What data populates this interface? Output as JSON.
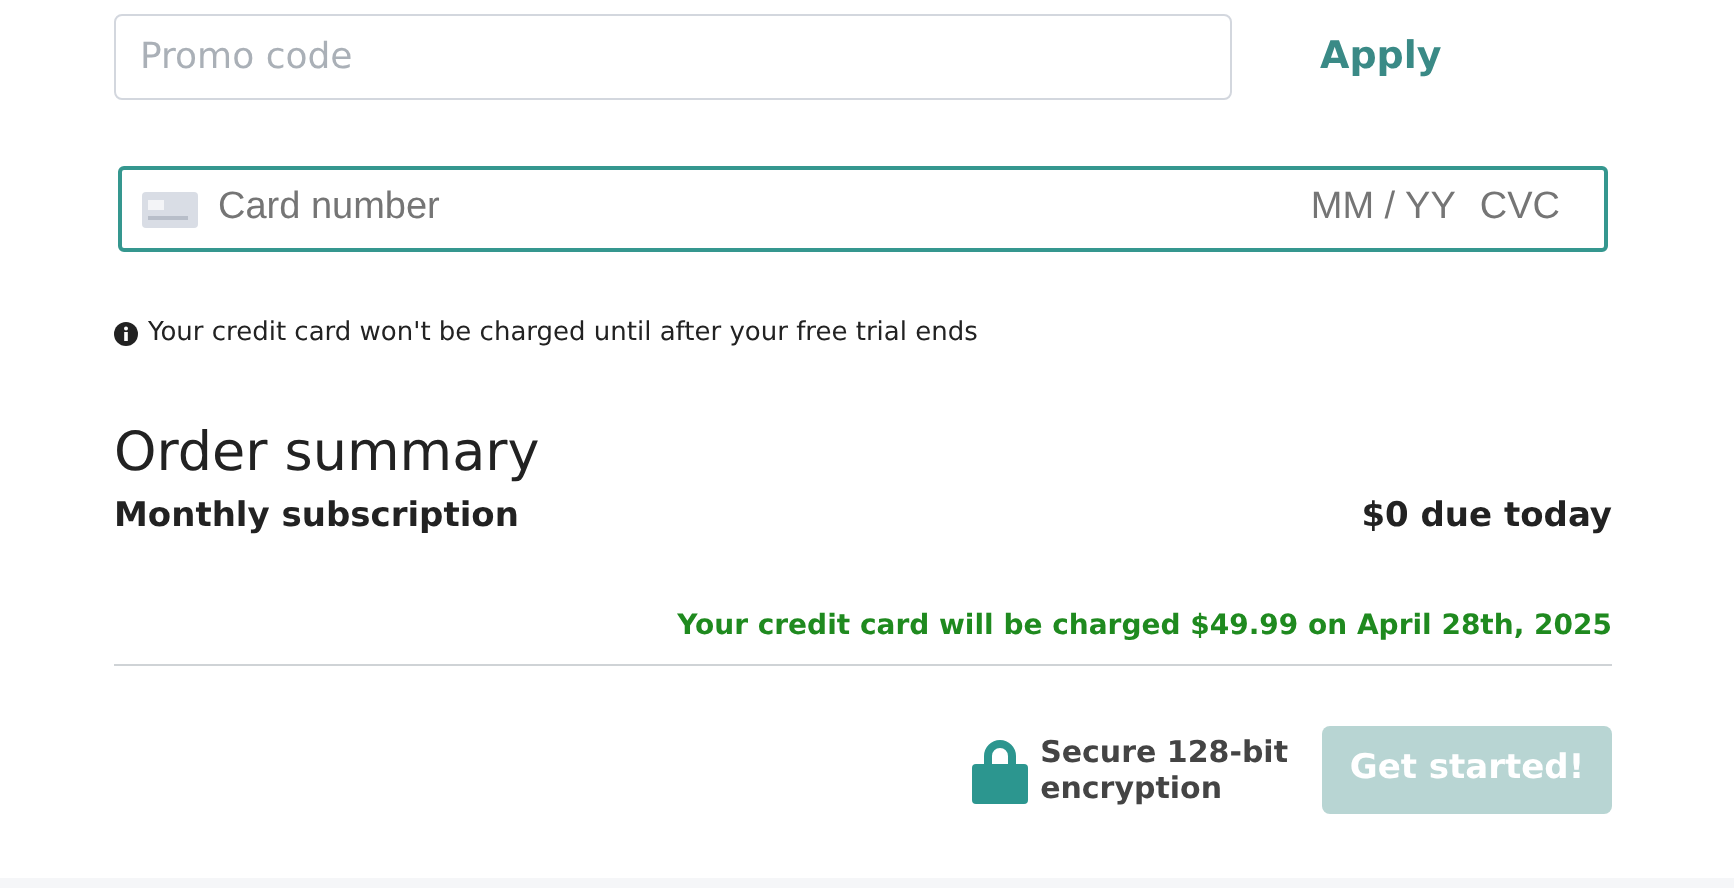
{
  "promo": {
    "placeholder": "Promo code",
    "apply_label": "Apply"
  },
  "card": {
    "placeholder": "Card number",
    "expiry_placeholder": "MM / YY",
    "cvc_placeholder": "CVC",
    "focused": true
  },
  "notice": "Your credit card won't be charged until after your free trial ends",
  "order_summary": {
    "title": "Order summary",
    "item": "Monthly subscription",
    "due": "$0 due today",
    "charge_note": "Your credit card will be charged $49.99 on April 28th, 2025"
  },
  "security": {
    "line_1": "Secure 128-bit",
    "line_2": "encryption"
  },
  "submit": {
    "label": "Get started!",
    "disabled": true
  }
}
